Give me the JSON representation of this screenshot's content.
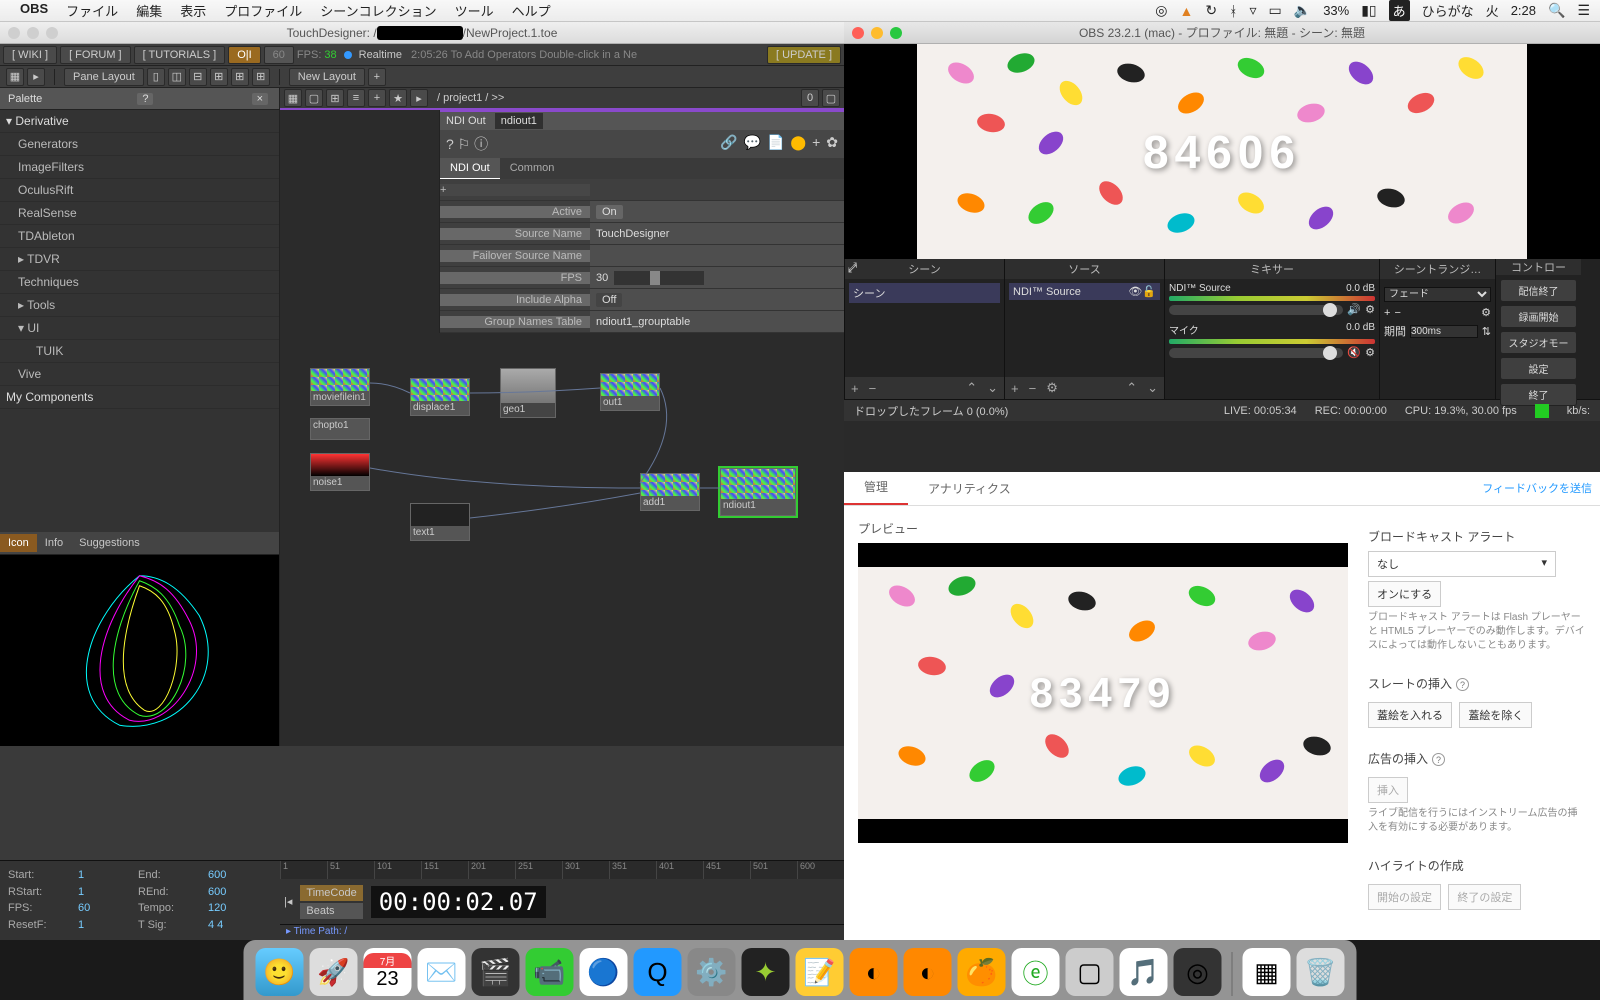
{
  "menubar": {
    "app": "OBS",
    "items": [
      "ファイル",
      "編集",
      "表示",
      "プロファイル",
      "シーンコレクション",
      "ツール",
      "ヘルプ"
    ],
    "right": {
      "battery": "33%",
      "ime": "あ",
      "ime_label": "ひらがな",
      "day": "火",
      "time": "2:28"
    }
  },
  "td": {
    "title_prefix": "TouchDesigner: /",
    "title_suffix": "/NewProject.1.toe",
    "top_links": [
      "[ WIKI ]",
      "[ FORUM ]",
      "[ TUTORIALS ]"
    ],
    "fps_label": "FPS:",
    "fps_val": "38",
    "realtime": "Realtime",
    "tip": "2:05:26 To Add Operators Double-click in a Ne",
    "update": "[ UPDATE ]",
    "pane_layout": "Pane Layout",
    "new_layout": "New Layout",
    "palette": {
      "title": "Palette",
      "groups": {
        "derivative": "Derivative",
        "items": [
          "Generators",
          "ImageFilters",
          "OculusRift",
          "RealSense",
          "TDAbleton",
          "TDVR",
          "Techniques",
          "Tools",
          "UI",
          "TUIK",
          "Vive"
        ],
        "mycomp": "My Components"
      }
    },
    "preview_tabs": [
      "Icon",
      "Info",
      "Suggestions"
    ],
    "network": {
      "path": "/ project1 / >>",
      "operator": {
        "type": "NDI Out",
        "name": "ndiout1"
      },
      "param_tabs": [
        "NDI Out",
        "Common"
      ],
      "params": {
        "active_label": "Active",
        "active_val": "On",
        "source_name_label": "Source Name",
        "source_name_val": "TouchDesigner",
        "failover_label": "Failover Source Name",
        "failover_val": "",
        "fps_label": "FPS",
        "fps_val": "30",
        "alpha_label": "Include Alpha",
        "alpha_val": "Off",
        "group_label": "Group Names Table",
        "group_val": "ndiout1_grouptable"
      },
      "nodes": {
        "moviefilein1": "moviefilein1",
        "displace1": "displace1",
        "geo1": "geo1",
        "out1": "out1",
        "chopto1": "chopto1",
        "noise1": "noise1",
        "add1": "add1",
        "ndiout1": "ndiout1",
        "text1": "text1"
      }
    },
    "timeline": {
      "start_l": "Start:",
      "start_v": "1",
      "end_l": "End:",
      "end_v": "600",
      "rstart_l": "RStart:",
      "rstart_v": "1",
      "rend_l": "REnd:",
      "rend_v": "600",
      "fps_l": "FPS:",
      "fps_v": "60",
      "tempo_l": "Tempo:",
      "tempo_v": "120",
      "resetf_l": "ResetF:",
      "resetf_v": "1",
      "tsig_l": "T Sig:",
      "tsig_v": "4   4",
      "ruler": [
        "1",
        "51",
        "101",
        "151",
        "201",
        "251",
        "301",
        "351",
        "401",
        "451",
        "501",
        "600"
      ],
      "timecode_l": "TimeCode",
      "beats_l": "Beats",
      "timecode": "00:00:02.07",
      "timepath": "Time Path: /"
    }
  },
  "obs": {
    "title": "OBS 23.2.1 (mac) - プロファイル: 無題 - シーン: 無題",
    "preview_number": "84606",
    "panels": {
      "scenes": "シーン",
      "scene_item": "シーン",
      "sources": "ソース",
      "source_item": "NDI™ Source",
      "mixer": "ミキサー",
      "mix1_name": "NDI™ Source",
      "mix1_db": "0.0 dB",
      "mix2_name": "マイク",
      "mix2_db": "0.0 dB",
      "trans": "シーントランジ…",
      "trans_mode": "フェード",
      "trans_dur_l": "期間",
      "trans_dur_v": "300ms",
      "controls": "コントロー",
      "btns": [
        "配信終了",
        "録画開始",
        "スタジオモー",
        "設定",
        "終了"
      ]
    },
    "status": {
      "dropped": "ドロップしたフレーム 0 (0.0%)",
      "live_l": "LIVE:",
      "live_v": "00:05:34",
      "rec_l": "REC:",
      "rec_v": "00:00:00",
      "cpu": "CPU: 19.3%, 30.00 fps",
      "kbps": "kb/s:"
    }
  },
  "browser": {
    "tabs": [
      "管理",
      "アナリティクス"
    ],
    "feedback": "フィードバックを送信",
    "preview_label": "プレビュー",
    "preview_number": "83479",
    "right": {
      "h1": "ブロードキャスト アラート",
      "sel": "なし",
      "btn_on": "オンにする",
      "note1": "ブロードキャスト アラートは Flash プレーヤーと HTML5 プレーヤーでのみ動作します。デバイスによっては動作しないこともあります。",
      "h2": "スレートの挿入",
      "btn_in": "蓋絵を入れる",
      "btn_out": "蓋絵を除く",
      "h3": "広告の挿入",
      "btn_ad": "挿入",
      "note2": "ライブ配信を行うにはインストリーム広告の挿入を有効にする必要があります。",
      "h4": "ハイライトの作成",
      "btn_h1": "開始の設定",
      "btn_h2": "終了の設定"
    }
  },
  "dock": [
    "finder",
    "launchpad",
    "calendar",
    "mail",
    "fcpx",
    "facetime",
    "chrome",
    "quicktime",
    "settings",
    "resolve",
    "notes",
    "blender",
    "blender2",
    "fl",
    "evernote",
    "wikipedia",
    "music",
    "obs",
    "",
    "desktop",
    "trash"
  ],
  "calendar_day": "23"
}
